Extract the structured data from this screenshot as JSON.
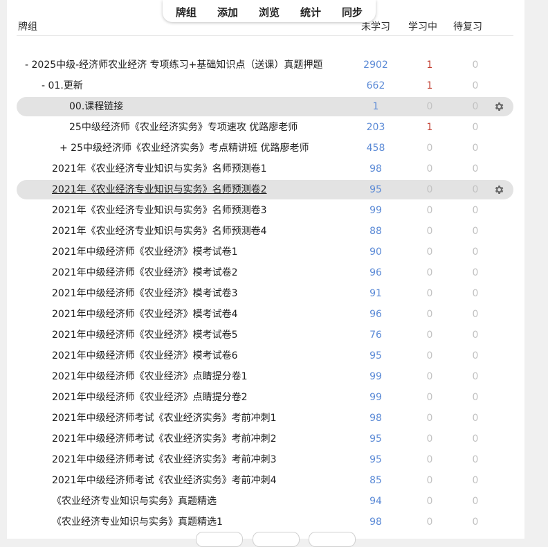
{
  "topbar": {
    "decks": "牌组",
    "add": "添加",
    "browse": "浏览",
    "stats": "统计",
    "sync": "同步"
  },
  "header": {
    "deck": "牌组",
    "new": "未学习",
    "learn": "学习中",
    "due": "待复习"
  },
  "rows": [
    {
      "name": "- 2025中级-经济师农业经济 专项练习+基础知识点（送课）真题押题",
      "new": "2902",
      "learn": "1",
      "due": "0"
    },
    {
      "name": "- 01.更新",
      "new": "662",
      "learn": "1",
      "due": "0"
    },
    {
      "name": "00.课程链接",
      "new": "1",
      "learn": "0",
      "due": "0",
      "highlight": true
    },
    {
      "name": "25中级经济师《农业经济实务》专项速攻 优路廖老师",
      "new": "203",
      "learn": "1",
      "due": "0"
    },
    {
      "name": "+ 25中级经济师《农业经济实务》考点精讲班 优路廖老师",
      "new": "458",
      "learn": "0",
      "due": "0"
    },
    {
      "name": "2021年《农业经济专业知识与实务》名师预测卷1",
      "new": "98",
      "learn": "0",
      "due": "0"
    },
    {
      "name": "2021年《农业经济专业知识与实务》名师预测卷2",
      "new": "95",
      "learn": "0",
      "due": "0",
      "highlight": true,
      "underline": true
    },
    {
      "name": "2021年《农业经济专业知识与实务》名师预测卷3",
      "new": "99",
      "learn": "0",
      "due": "0"
    },
    {
      "name": "2021年《农业经济专业知识与实务》名师预测卷4",
      "new": "88",
      "learn": "0",
      "due": "0"
    },
    {
      "name": "2021年中级经济师《农业经济》模考试卷1",
      "new": "90",
      "learn": "0",
      "due": "0"
    },
    {
      "name": "2021年中级经济师《农业经济》模考试卷2",
      "new": "96",
      "learn": "0",
      "due": "0"
    },
    {
      "name": "2021年中级经济师《农业经济》模考试卷3",
      "new": "91",
      "learn": "0",
      "due": "0"
    },
    {
      "name": "2021年中级经济师《农业经济》模考试卷4",
      "new": "96",
      "learn": "0",
      "due": "0"
    },
    {
      "name": "2021年中级经济师《农业经济》模考试卷5",
      "new": "76",
      "learn": "0",
      "due": "0"
    },
    {
      "name": "2021年中级经济师《农业经济》模考试卷6",
      "new": "95",
      "learn": "0",
      "due": "0"
    },
    {
      "name": "2021年中级经济师《农业经济》点睛提分卷1",
      "new": "99",
      "learn": "0",
      "due": "0"
    },
    {
      "name": "2021年中级经济师《农业经济》点睛提分卷2",
      "new": "99",
      "learn": "0",
      "due": "0"
    },
    {
      "name": "2021年中级经济师考试《农业经济实务》考前冲刺1",
      "new": "98",
      "learn": "0",
      "due": "0"
    },
    {
      "name": "2021年中级经济师考试《农业经济实务》考前冲刺2",
      "new": "95",
      "learn": "0",
      "due": "0"
    },
    {
      "name": "2021年中级经济师考试《农业经济实务》考前冲刺3",
      "new": "95",
      "learn": "0",
      "due": "0"
    },
    {
      "name": "2021年中级经济师考试《农业经济实务》考前冲刺4",
      "new": "85",
      "learn": "0",
      "due": "0"
    },
    {
      "name": "《农业经济专业知识与实务》真题精选",
      "new": "94",
      "learn": "0",
      "due": "0"
    },
    {
      "name": "《农业经济专业知识与实务》真题精选1",
      "new": "98",
      "learn": "0",
      "due": "0"
    }
  ],
  "colors": {
    "new": "#5b8ad6",
    "learn": "#c0392b",
    "zero": "#c2c2c2",
    "highlight": "#e3e3e3"
  }
}
